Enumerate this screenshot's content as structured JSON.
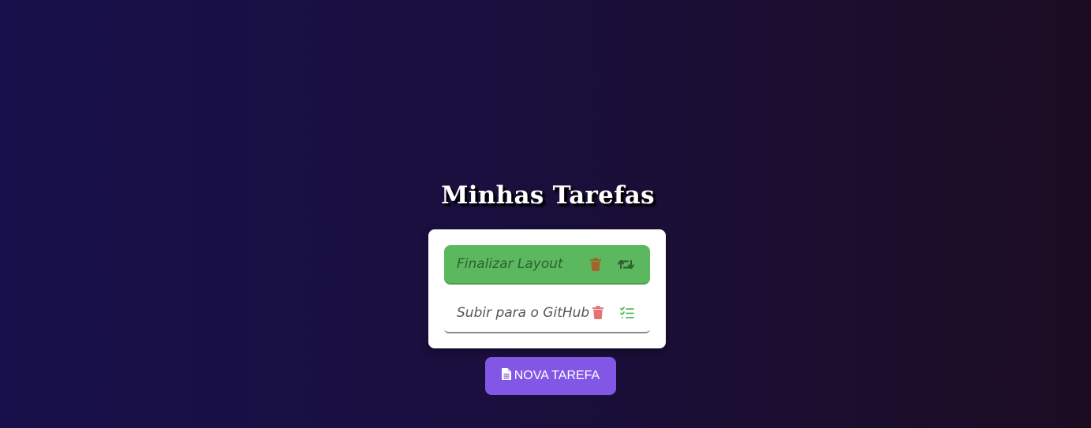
{
  "page": {
    "title": "Minhas Tarefas"
  },
  "tasks": [
    {
      "label": "Finalizar Layout",
      "status": "done",
      "delete_icon": "trash-icon",
      "toggle_icon": "retweet-icon"
    },
    {
      "label": "Subir para o GitHub",
      "status": "pending",
      "delete_icon": "trash-icon",
      "toggle_icon": "checklist-icon"
    }
  ],
  "new_task_button": {
    "label": "NOVA TAREFA",
    "icon": "file-text-icon"
  },
  "colors": {
    "done_background": "#5cb85f",
    "done_text": "#2f5e31",
    "done_trash": "#a0642c",
    "pending_trash": "#e57373",
    "pending_check": "#5cb85f",
    "button_background": "#8357e6"
  }
}
